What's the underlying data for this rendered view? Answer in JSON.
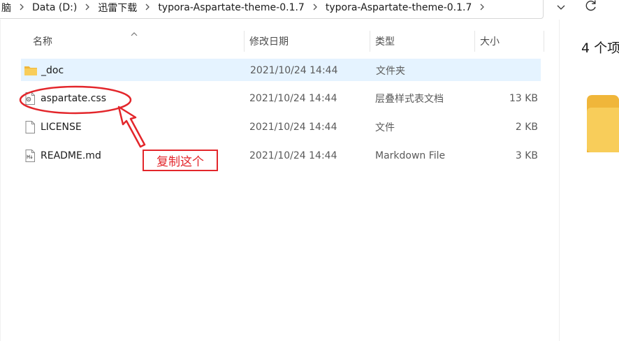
{
  "breadcrumb": {
    "items": [
      "脑",
      "Data (D:)",
      "迅雷下载",
      "typora-Aspartate-theme-0.1.7",
      "typora-Aspartate-theme-0.1.7"
    ],
    "separator_icon": "chevron-right-icon",
    "dropdown_icon": "chevron-down-icon",
    "refresh_icon": "refresh-icon"
  },
  "columns": {
    "name": "名称",
    "date": "修改日期",
    "type": "类型",
    "size": "大小",
    "sort_icon": "sort-ascending-icon"
  },
  "files": [
    {
      "name": "_doc",
      "date": "2021/10/24 14:44",
      "type": "文件夹",
      "size": "",
      "icon": "folder-icon",
      "selected": true
    },
    {
      "name": "aspartate.css",
      "date": "2021/10/24 14:44",
      "type": "层叠样式表文档",
      "size": "13 KB",
      "icon": "css-file-icon",
      "selected": false
    },
    {
      "name": "LICENSE",
      "date": "2021/10/24 14:44",
      "type": "文件",
      "size": "2 KB",
      "icon": "file-icon",
      "selected": false
    },
    {
      "name": "README.md",
      "date": "2021/10/24 14:44",
      "type": "Markdown File",
      "size": "3 KB",
      "icon": "markdown-file-icon",
      "selected": false
    }
  ],
  "annotation": {
    "label": "复制这个",
    "color": "#e3262b"
  },
  "details": {
    "count_text": "4 个项",
    "folder_icon": "folder-icon"
  },
  "colors": {
    "selection": "#e5f3ff",
    "folder": "#f5c445"
  }
}
